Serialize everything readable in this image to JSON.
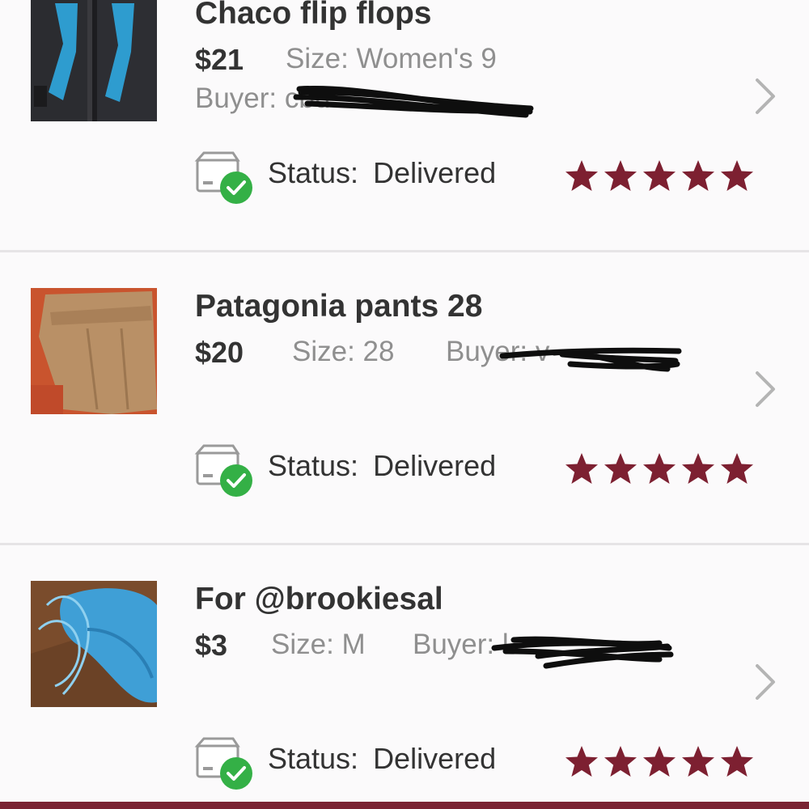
{
  "colors": {
    "star": "#7d2031",
    "check": "#34b046",
    "divider": "#e6e4e6",
    "brand_bar": "#7a2333"
  },
  "orders": [
    {
      "title": "Chaco flip flops",
      "price": "$21",
      "size": "Size: Women's 9",
      "buyer": "Buyer: cbu",
      "status_label": "Status:",
      "status_value": "Delivered",
      "rating": 5,
      "thumbnail": "flip-flops-photo"
    },
    {
      "title": "Patagonia pants 28",
      "price": "$20",
      "size": "Size: 28",
      "buyer": "Buyer: v",
      "status_label": "Status:",
      "status_value": "Delivered",
      "rating": 5,
      "thumbnail": "pants-photo"
    },
    {
      "title": "For @brookiesal",
      "price": "$3",
      "size": "Size: M",
      "buyer": "Buyer: l",
      "status_label": "Status:",
      "status_value": "Delivered",
      "rating": 5,
      "thumbnail": "bikini-photo"
    }
  ]
}
